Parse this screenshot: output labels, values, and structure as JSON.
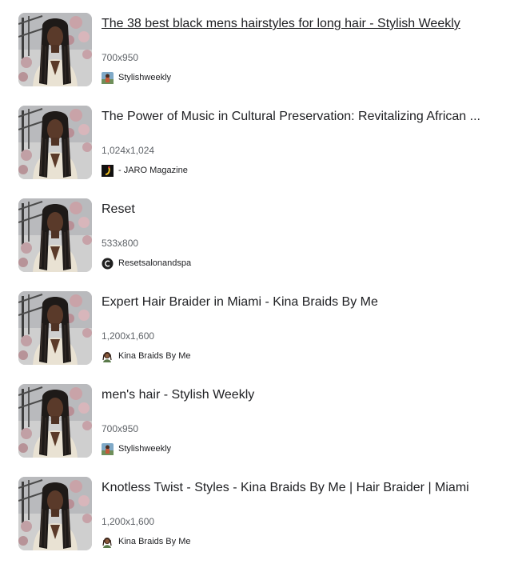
{
  "results": [
    {
      "title": "The 38 best black mens hairstyles for long hair - Stylish Weekly",
      "dimensions": "700x950",
      "source": "Stylishweekly",
      "favicon": "stylishweekly-icon",
      "hovered": true
    },
    {
      "title": "The Power of Music in Cultural Preservation: Revitalizing African ...",
      "dimensions": "1,024x1,024",
      "source": "- JARO Magazine",
      "favicon": "jaro-magazine-icon",
      "hovered": false
    },
    {
      "title": "Reset",
      "dimensions": "533x800",
      "source": "Resetsalonandspa",
      "favicon": "reset-salon-icon",
      "hovered": false
    },
    {
      "title": "Expert Hair Braider in Miami - Kina Braids By Me",
      "dimensions": "1,200x1,600",
      "source": "Kina Braids By Me",
      "favicon": "kina-braids-icon",
      "hovered": false
    },
    {
      "title": "men's hair - Stylish Weekly",
      "dimensions": "700x950",
      "source": "Stylishweekly",
      "favicon": "stylishweekly-icon",
      "hovered": false
    },
    {
      "title": "Knotless Twist - Styles - Kina Braids By Me | Hair Braider | Miami",
      "dimensions": "1,200x1,600",
      "source": "Kina Braids By Me",
      "favicon": "kina-braids-icon",
      "hovered": false
    }
  ]
}
